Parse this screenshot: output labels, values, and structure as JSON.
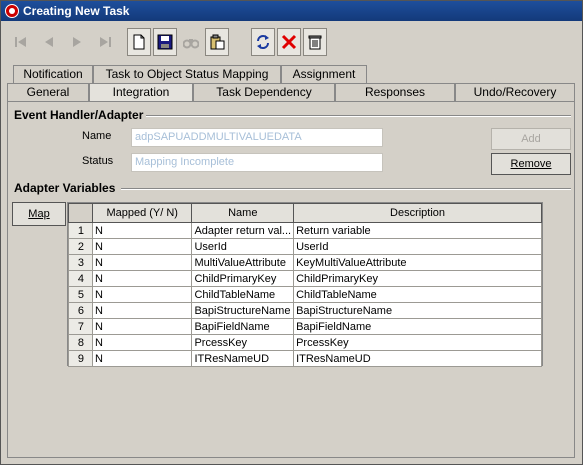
{
  "window": {
    "title": "Creating New Task"
  },
  "toolbar": {
    "icons": [
      "first-icon",
      "prev-icon",
      "next-icon",
      "last-icon",
      "new-icon",
      "save-icon",
      "find-icon",
      "paste-icon",
      "refresh-icon",
      "delete-icon",
      "trash-icon"
    ]
  },
  "tabs_top": [
    {
      "label": "Notification"
    },
    {
      "label": "Task to Object Status Mapping"
    },
    {
      "label": "Assignment"
    }
  ],
  "tabs_bottom": [
    {
      "label": "General"
    },
    {
      "label": "Integration",
      "active": true
    },
    {
      "label": "Task Dependency"
    },
    {
      "label": "Responses"
    },
    {
      "label": "Undo/Recovery"
    }
  ],
  "event_handler": {
    "title": "Event Handler/Adapter",
    "name_label": "Name",
    "name_value": "adpSAPUADDMULTIVALUEDATA",
    "status_label": "Status",
    "status_value": "Mapping Incomplete",
    "add_label": "Add",
    "remove_label": "Remove"
  },
  "adapter_vars": {
    "title": "Adapter Variables",
    "map_label": "Map",
    "columns": [
      "Mapped (Y/ N)",
      "Name",
      "Description"
    ],
    "rows": [
      {
        "num": "1",
        "mapped": "N",
        "name": "Adapter return val...",
        "desc": "Return variable"
      },
      {
        "num": "2",
        "mapped": "N",
        "name": "UserId",
        "desc": "UserId"
      },
      {
        "num": "3",
        "mapped": "N",
        "name": "MultiValueAttribute",
        "desc": "KeyMultiValueAttribute"
      },
      {
        "num": "4",
        "mapped": "N",
        "name": "ChildPrimaryKey",
        "desc": "ChildPrimaryKey"
      },
      {
        "num": "5",
        "mapped": "N",
        "name": "ChildTableName",
        "desc": "ChildTableName"
      },
      {
        "num": "6",
        "mapped": "N",
        "name": "BapiStructureName",
        "desc": "BapiStructureName"
      },
      {
        "num": "7",
        "mapped": "N",
        "name": "BapiFieldName",
        "desc": "BapiFieldName"
      },
      {
        "num": "8",
        "mapped": "N",
        "name": "PrcessKey",
        "desc": "PrcessKey"
      },
      {
        "num": "9",
        "mapped": "N",
        "name": "ITResNameUD",
        "desc": "ITResNameUD"
      }
    ]
  }
}
